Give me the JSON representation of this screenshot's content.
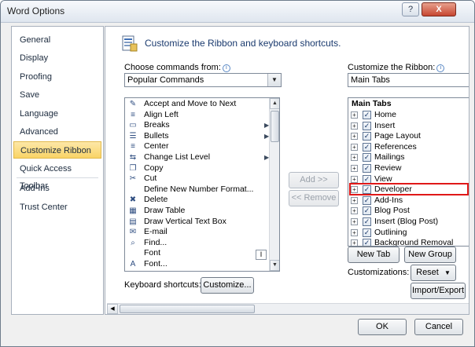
{
  "window": {
    "title": "Word Options",
    "help_glyph": "?",
    "close_glyph": "X"
  },
  "nav": {
    "items": [
      {
        "label": "General"
      },
      {
        "label": "Display"
      },
      {
        "label": "Proofing"
      },
      {
        "label": "Save"
      },
      {
        "label": "Language"
      },
      {
        "label": "Advanced"
      },
      {
        "label": "Customize Ribbon",
        "selected": true
      },
      {
        "label": "Quick Access Toolbar"
      },
      {
        "label": "Add-Ins"
      },
      {
        "label": "Trust Center"
      }
    ]
  },
  "main": {
    "header": "Customize the Ribbon and keyboard shortcuts.",
    "choose_label": "Choose commands from:",
    "choose_value": "Popular Commands",
    "customize_label": "Customize the Ribbon:",
    "customize_value": "Main Tabs",
    "commands": [
      {
        "label": "Accept and Move to Next",
        "icon": "accept-icon",
        "glyph": "✎"
      },
      {
        "label": "Align Left",
        "icon": "align-left-icon",
        "glyph": "≡"
      },
      {
        "label": "Breaks",
        "icon": "breaks-icon",
        "glyph": "▭",
        "submenu": true
      },
      {
        "label": "Bullets",
        "icon": "bullets-icon",
        "glyph": "☰",
        "submenu": true
      },
      {
        "label": "Center",
        "icon": "center-icon",
        "glyph": "≡"
      },
      {
        "label": "Change List Level",
        "icon": "list-level-icon",
        "glyph": "⇆",
        "submenu": true
      },
      {
        "label": "Copy",
        "icon": "copy-icon",
        "glyph": "❐"
      },
      {
        "label": "Cut",
        "icon": "cut-icon",
        "glyph": "✂"
      },
      {
        "label": "Define New Number Format...",
        "icon": "",
        "glyph": ""
      },
      {
        "label": "Delete",
        "icon": "delete-icon",
        "glyph": "✖"
      },
      {
        "label": "Draw Table",
        "icon": "draw-table-icon",
        "glyph": "▦"
      },
      {
        "label": "Draw Vertical Text Box",
        "icon": "text-box-icon",
        "glyph": "▤"
      },
      {
        "label": "E-mail",
        "icon": "email-icon",
        "glyph": "✉"
      },
      {
        "label": "Find...",
        "icon": "find-icon",
        "glyph": "⌕"
      },
      {
        "label": "Font",
        "icon": "",
        "glyph": ""
      },
      {
        "label": "Font...",
        "icon": "font-icon",
        "glyph": "A"
      }
    ],
    "font_size_glyph": "I",
    "add_button": "Add >>",
    "remove_button": "<< Remove",
    "tree_header": "Main Tabs",
    "tabs": [
      {
        "label": "Home",
        "checked": true
      },
      {
        "label": "Insert",
        "checked": true
      },
      {
        "label": "Page Layout",
        "checked": true
      },
      {
        "label": "References",
        "checked": true
      },
      {
        "label": "Mailings",
        "checked": true
      },
      {
        "label": "Review",
        "checked": true
      },
      {
        "label": "View",
        "checked": true
      },
      {
        "label": "Developer",
        "checked": true,
        "highlighted": true
      },
      {
        "label": "Add-Ins",
        "checked": true
      },
      {
        "label": "Blog Post",
        "checked": true
      },
      {
        "label": "Insert (Blog Post)",
        "checked": true
      },
      {
        "label": "Outlining",
        "checked": true
      },
      {
        "label": "Background Removal",
        "checked": true
      }
    ],
    "expander_glyph": "+",
    "check_glyph": "✓",
    "new_tab_button": "New Tab",
    "new_group_button": "New Group",
    "customizations_label": "Customizations:",
    "reset_button": "Reset",
    "import_export_button": "Import/Export",
    "keyboard_label": "Keyboard shortcuts:",
    "customize_button": "Customize..."
  },
  "footer": {
    "ok_button": "OK",
    "cancel_button": "Cancel"
  },
  "colors": {
    "accent_selected": "#f9d466",
    "highlight_red": "#e01818",
    "header_text": "#1a3a6e"
  }
}
